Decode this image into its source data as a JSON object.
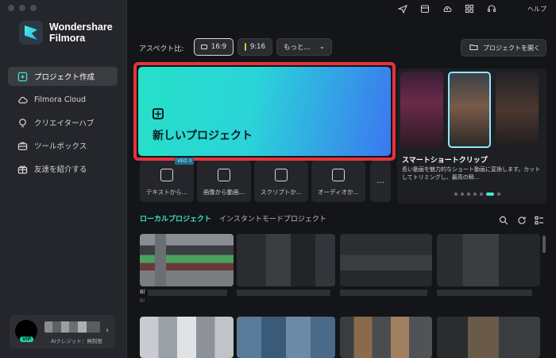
{
  "app": {
    "logo_line1": "Wondershare",
    "logo_line2": "Filmora"
  },
  "sidebar": {
    "items": [
      {
        "label": "プロジェクト作成",
        "icon": "add-project-icon",
        "active": true
      },
      {
        "label": "Filmora Cloud",
        "icon": "cloud-icon",
        "active": false
      },
      {
        "label": "クリエイターハブ",
        "icon": "lightbulb-icon",
        "active": false
      },
      {
        "label": "ツールボックス",
        "icon": "toolbox-icon",
        "active": false
      },
      {
        "label": "友達を紹介する",
        "icon": "gift-icon",
        "active": false
      }
    ],
    "account": {
      "vip_badge": "VIP",
      "credit": "AIクレジット：無制限"
    }
  },
  "topbar": {
    "icons": [
      "send-icon",
      "calendar-icon",
      "cloud-upload-icon",
      "grid-icon",
      "headset-icon"
    ],
    "help": "ヘルプ"
  },
  "aspect": {
    "label": "アスペクト比:",
    "options": [
      "16:9",
      "9:16"
    ],
    "more": "もっと..."
  },
  "open_project": "プロジェクトを開く",
  "new_project": {
    "plus": "+",
    "label": "新しいプロジェクト"
  },
  "tools": [
    {
      "label": "テキストから...",
      "badge": "VEO 3"
    },
    {
      "label": "画像から動画..."
    },
    {
      "label": "スクリプトか..."
    },
    {
      "label": "オーディオか..."
    }
  ],
  "tool_more": "...",
  "promo": {
    "title": "スマートショートクリップ",
    "description": "長い動画を魅力的なショート動画に変換します。カットしてトリミングし、最高の瞬..."
  },
  "tabs": {
    "local": "ローカルプロジェクト",
    "instant": "インスタントモードプロジェクト"
  },
  "projects": {
    "first_title": "Bl",
    "first_sub": "0!"
  },
  "colors": {
    "accent": "#3fe0c6",
    "highlight_border": "#e8323a"
  }
}
